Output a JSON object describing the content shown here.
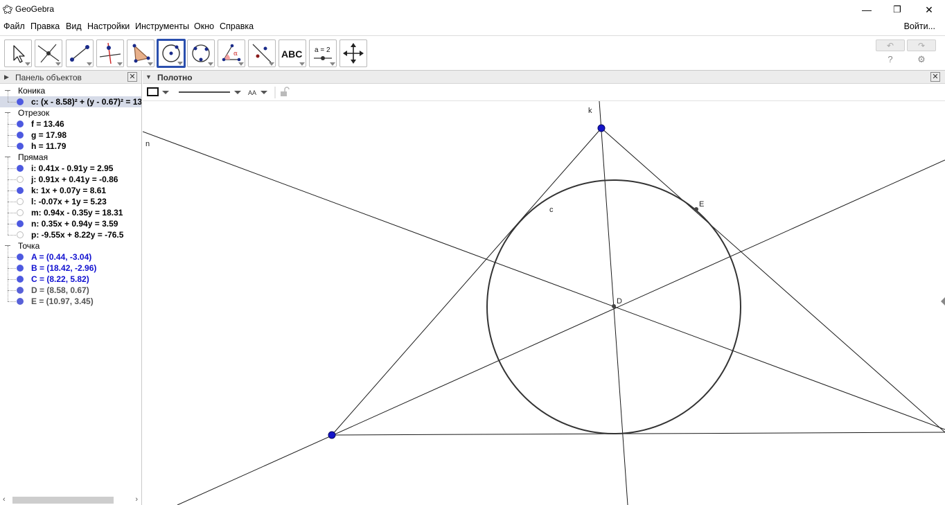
{
  "window": {
    "title": "GeoGebra",
    "minimize": "—",
    "maximize": "❐",
    "close": "✕"
  },
  "menu": {
    "items": [
      "Файл",
      "Правка",
      "Вид",
      "Настройки",
      "Инструменты",
      "Окно",
      "Справка"
    ],
    "login": "Войти..."
  },
  "toolbar": {
    "tools": [
      {
        "icon": "move-arrow-icon",
        "selected": false
      },
      {
        "icon": "intersect-point-icon",
        "selected": false
      },
      {
        "icon": "segment-icon",
        "selected": false
      },
      {
        "icon": "perpendicular-line-icon",
        "selected": false
      },
      {
        "icon": "polygon-icon",
        "selected": false
      },
      {
        "icon": "circle-center-point-icon",
        "selected": true
      },
      {
        "icon": "circle-three-points-icon",
        "selected": false
      },
      {
        "icon": "angle-icon",
        "selected": false
      },
      {
        "icon": "reflect-icon",
        "selected": false
      },
      {
        "icon": "text-icon",
        "selected": false
      },
      {
        "icon": "slider-icon",
        "selected": false
      },
      {
        "icon": "move-graphics-icon",
        "selected": false
      }
    ],
    "text_tool_label": "ABC",
    "slider_tool_label": "a = 2",
    "angle_tool_label": "α",
    "help": "?",
    "settings": "⚙",
    "undo": "↶",
    "redo": "↷"
  },
  "algebra": {
    "header": "Панель объектов",
    "categories": [
      {
        "name": "Коника",
        "items": [
          {
            "text": "c: (x - 8.58)² + (y - 0.67)² = 13",
            "visible": true,
            "style": "black",
            "selected": true
          }
        ]
      },
      {
        "name": "Отрезок",
        "items": [
          {
            "text": "f = 13.46",
            "visible": true,
            "style": "black"
          },
          {
            "text": "g = 17.98",
            "visible": true,
            "style": "black"
          },
          {
            "text": "h = 11.79",
            "visible": true,
            "style": "black"
          }
        ]
      },
      {
        "name": "Прямая",
        "items": [
          {
            "text": "i: 0.41x - 0.91y = 2.95",
            "visible": true,
            "style": "black"
          },
          {
            "text": "j: 0.91x + 0.41y = -0.86",
            "visible": false,
            "style": "black"
          },
          {
            "text": "k: 1x + 0.07y = 8.61",
            "visible": true,
            "style": "black"
          },
          {
            "text": "l: -0.07x + 1y = 5.23",
            "visible": false,
            "style": "black"
          },
          {
            "text": "m: 0.94x - 0.35y = 18.31",
            "visible": false,
            "style": "black"
          },
          {
            "text": "n: 0.35x + 0.94y = 3.59",
            "visible": true,
            "style": "black"
          },
          {
            "text": "p: -9.55x + 8.22y = -76.5",
            "visible": false,
            "style": "black"
          }
        ]
      },
      {
        "name": "Точка",
        "items": [
          {
            "text": "A = (0.44, -3.04)",
            "visible": true,
            "style": "blue"
          },
          {
            "text": "B = (18.42, -2.96)",
            "visible": true,
            "style": "blue"
          },
          {
            "text": "C = (8.22, 5.82)",
            "visible": true,
            "style": "blue"
          },
          {
            "text": "D = (8.58, 0.67)",
            "visible": true,
            "style": "grey"
          },
          {
            "text": "E = (10.97, 3.45)",
            "visible": true,
            "style": "grey"
          }
        ]
      }
    ]
  },
  "graphics": {
    "header": "Полотно",
    "font_size_label": "AA",
    "labels": {
      "k": "k",
      "n": "n",
      "c": "c",
      "E": "E",
      "D": "D"
    },
    "colors": {
      "free_point": "#1414c8",
      "dependent_point": "#444444",
      "line": "#1a1a1a",
      "selected_tool_border": "#2a4fae"
    }
  }
}
